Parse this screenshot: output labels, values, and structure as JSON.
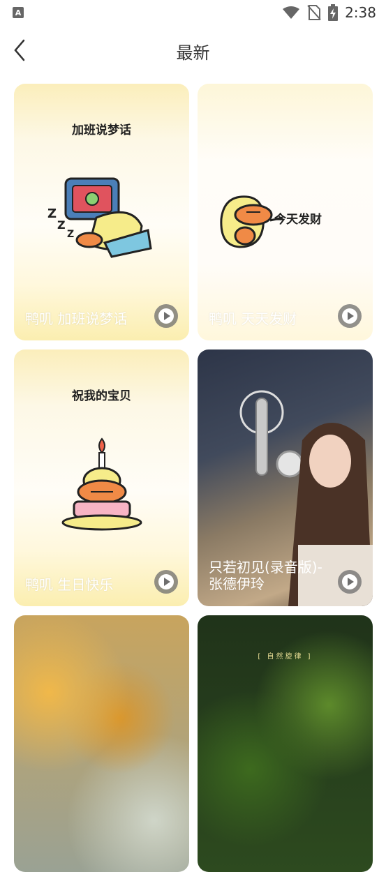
{
  "status_bar": {
    "left_icon": "A",
    "time": "2:38",
    "icons": [
      "wifi-icon",
      "no-sim-icon",
      "battery-charging-icon"
    ]
  },
  "header": {
    "title": "最新",
    "back_icon": "chevron-left-icon"
  },
  "cards": [
    {
      "caption": "鸭叽 加班说梦话",
      "sticker_title": "加班说梦话",
      "play_icon": "play-icon"
    },
    {
      "caption": "鸭叽 天天发财",
      "sticker_title": "今天发财",
      "play_icon": "play-icon"
    },
    {
      "caption": "鸭叽 生日快乐",
      "sticker_title": "祝我的宝贝",
      "play_icon": "play-icon"
    },
    {
      "caption": "只若初见(录音版)-张德伊玲",
      "play_icon": "play-icon"
    },
    {
      "caption": ""
    },
    {
      "caption": "",
      "overlay_text": "[ 自然旋律 ]"
    }
  ],
  "colors": {
    "header_text": "#333333",
    "card_yellow": "#fbeebb"
  }
}
